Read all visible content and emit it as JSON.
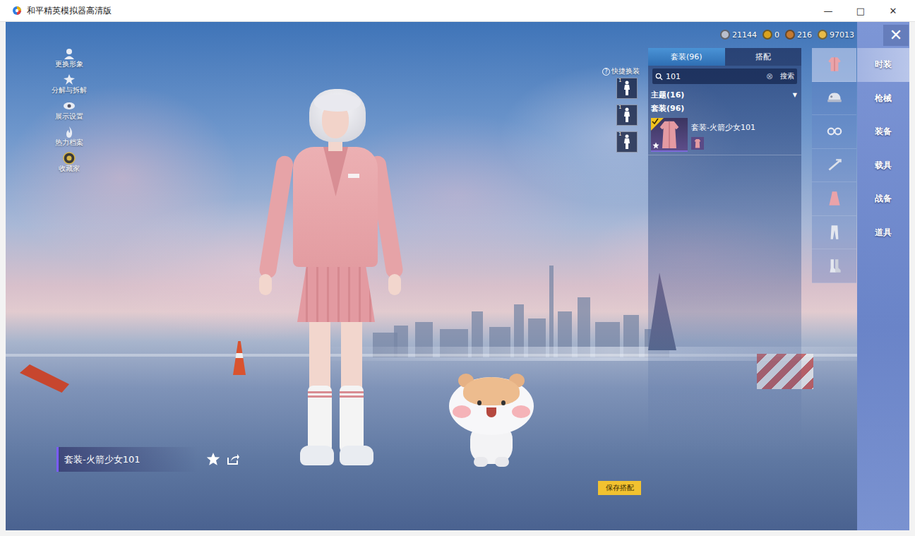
{
  "window": {
    "title": "和平精英模拟器高清版",
    "controls": [
      "—",
      "□",
      "✕"
    ]
  },
  "currencies": [
    {
      "amount": "21144",
      "color": "#b9bfcc"
    },
    {
      "amount": "0",
      "color": "#d9a21f"
    },
    {
      "amount": "216",
      "color": "#c47a32"
    },
    {
      "amount": "97013",
      "color": "#e8bb48"
    }
  ],
  "close": "✕",
  "left_menu": [
    {
      "label": "更换形象"
    },
    {
      "label": "分解与拆解"
    },
    {
      "label": "展示设置"
    },
    {
      "label": "热力档案"
    },
    {
      "label": "收藏家"
    }
  ],
  "quick_change": {
    "help": "?",
    "label": "快捷换装",
    "slots": [
      {
        "count": "1"
      },
      {
        "count": "1"
      },
      {
        "count": "1"
      }
    ]
  },
  "outfit_label": {
    "name": "套装-火箭少女101"
  },
  "save_button": "保存搭配",
  "panel": {
    "tabs": [
      {
        "label": "套装(96)",
        "selected": true
      },
      {
        "label": "搭配",
        "selected": false
      }
    ],
    "search": {
      "value": "101",
      "clear": "⊗",
      "button": "搜索"
    },
    "filter": {
      "label": "主题(16)",
      "arrow": "▼"
    },
    "section": "套装(96)",
    "items": [
      {
        "name": "套装-火箭少女101",
        "equipped": true
      }
    ]
  },
  "categories": [
    {
      "selected": true
    },
    {
      "selected": false
    },
    {
      "selected": false
    },
    {
      "selected": false
    },
    {
      "selected": false
    },
    {
      "selected": false
    },
    {
      "selected": false
    }
  ],
  "nav": [
    {
      "label": "时装",
      "selected": true
    },
    {
      "label": "枪械",
      "selected": false
    },
    {
      "label": "装备",
      "selected": false
    },
    {
      "label": "载具",
      "selected": false
    },
    {
      "label": "战备",
      "selected": false
    },
    {
      "label": "道具",
      "selected": false
    }
  ]
}
